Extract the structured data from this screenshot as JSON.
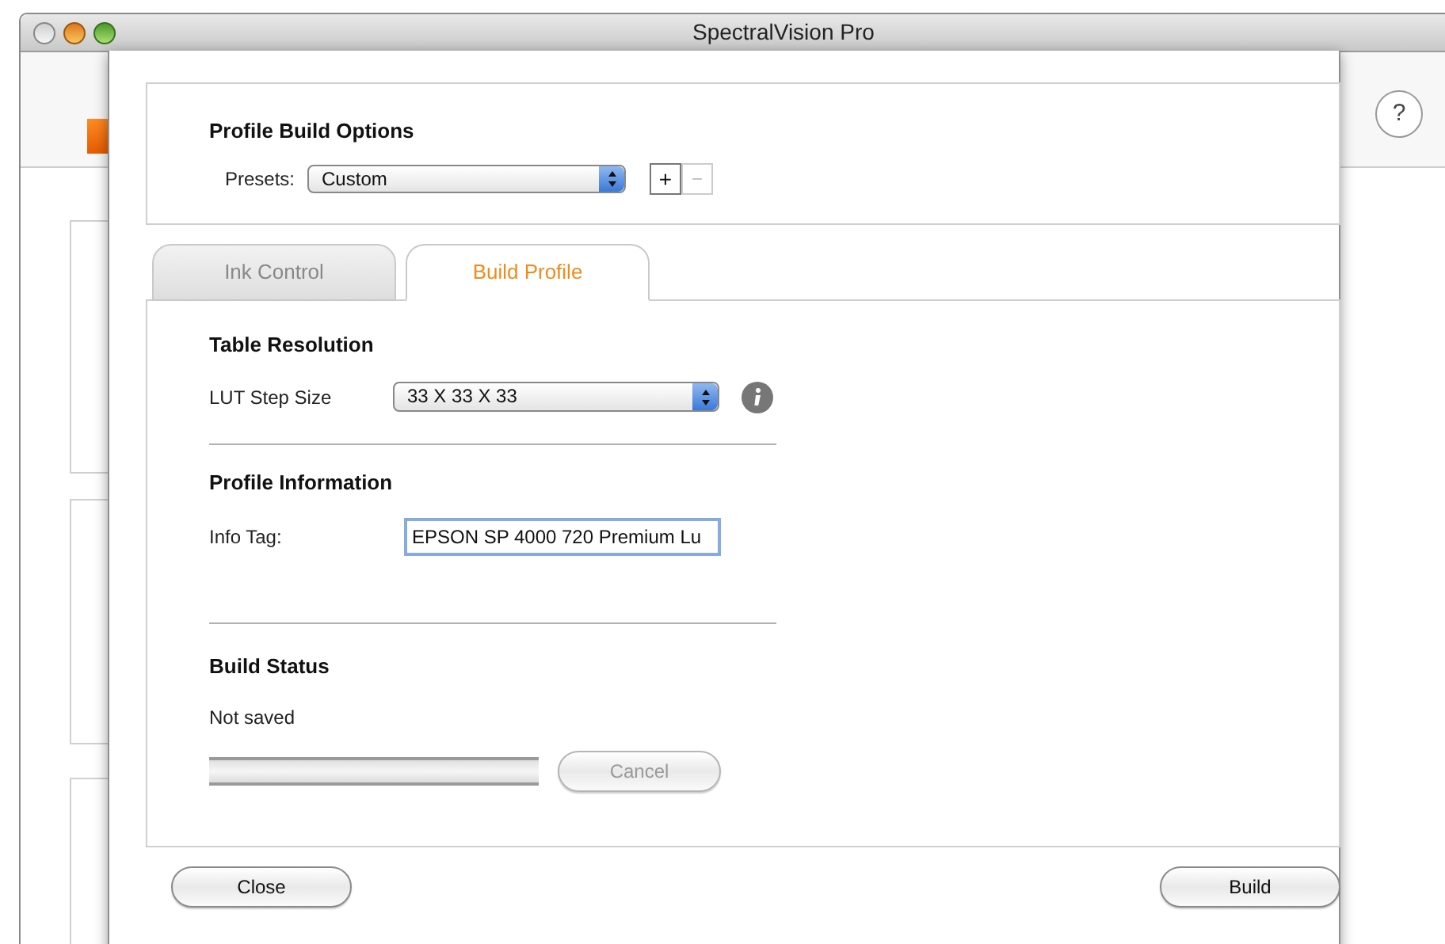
{
  "window": {
    "title": "SpectralVision Pro"
  },
  "profile_build_options": {
    "title": "Profile Build Options",
    "presets_label": "Presets:",
    "presets_value": "Custom",
    "add_button": {
      "label": "+",
      "disabled": false
    },
    "remove_button": {
      "label": "−",
      "disabled": true
    }
  },
  "tabs": [
    {
      "label": "Ink Control",
      "selected": false
    },
    {
      "label": "Build Profile",
      "selected": true
    }
  ],
  "table_resolution": {
    "title": "Table Resolution",
    "label": "LUT Step Size",
    "value": "33 X 33 X 33"
  },
  "profile_information": {
    "title": "Profile Information",
    "label": "Info Tag:",
    "value": "EPSON SP 4000 720 Premium Lu"
  },
  "build_status": {
    "title": "Build Status",
    "status": "Not saved",
    "level": 0,
    "cancel_button": {
      "label": "Cancel",
      "disabled": true
    }
  },
  "buttons": [
    {
      "label": "Close"
    },
    {
      "label": "Build"
    }
  ],
  "help_button": {
    "label": "?"
  }
}
